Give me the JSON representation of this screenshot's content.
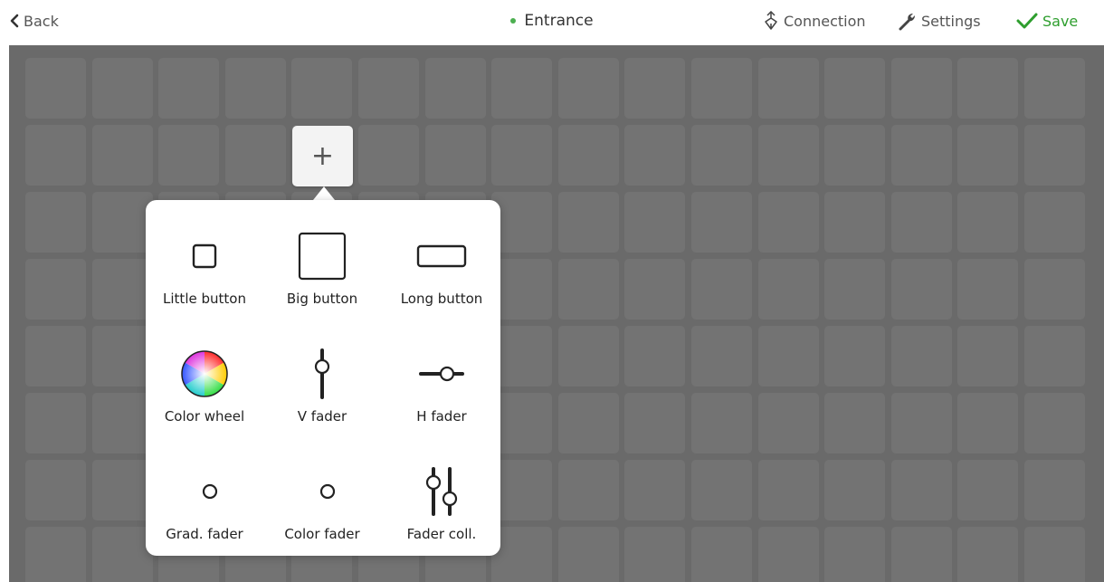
{
  "topbar": {
    "back_label": "Back",
    "title": "Entrance",
    "status_color": "#4caf50",
    "connection_label": "Connection",
    "settings_label": "Settings",
    "save_label": "Save",
    "save_color": "#2e9e2e"
  },
  "grid": {
    "columns": 16,
    "rows": 8
  },
  "add_button": {
    "label": "+"
  },
  "popup": {
    "options": [
      {
        "label": "Little button",
        "icon": "little-button-icon"
      },
      {
        "label": "Big button",
        "icon": "big-button-icon"
      },
      {
        "label": "Long button",
        "icon": "long-button-icon"
      },
      {
        "label": "Color wheel",
        "icon": "color-wheel-icon"
      },
      {
        "label": "V fader",
        "icon": "v-fader-icon"
      },
      {
        "label": "H fader",
        "icon": "h-fader-icon"
      },
      {
        "label": "Grad. fader",
        "icon": "grad-fader-icon"
      },
      {
        "label": "Color fader",
        "icon": "color-fader-icon"
      },
      {
        "label": "Fader coll.",
        "icon": "fader-collection-icon"
      }
    ]
  }
}
